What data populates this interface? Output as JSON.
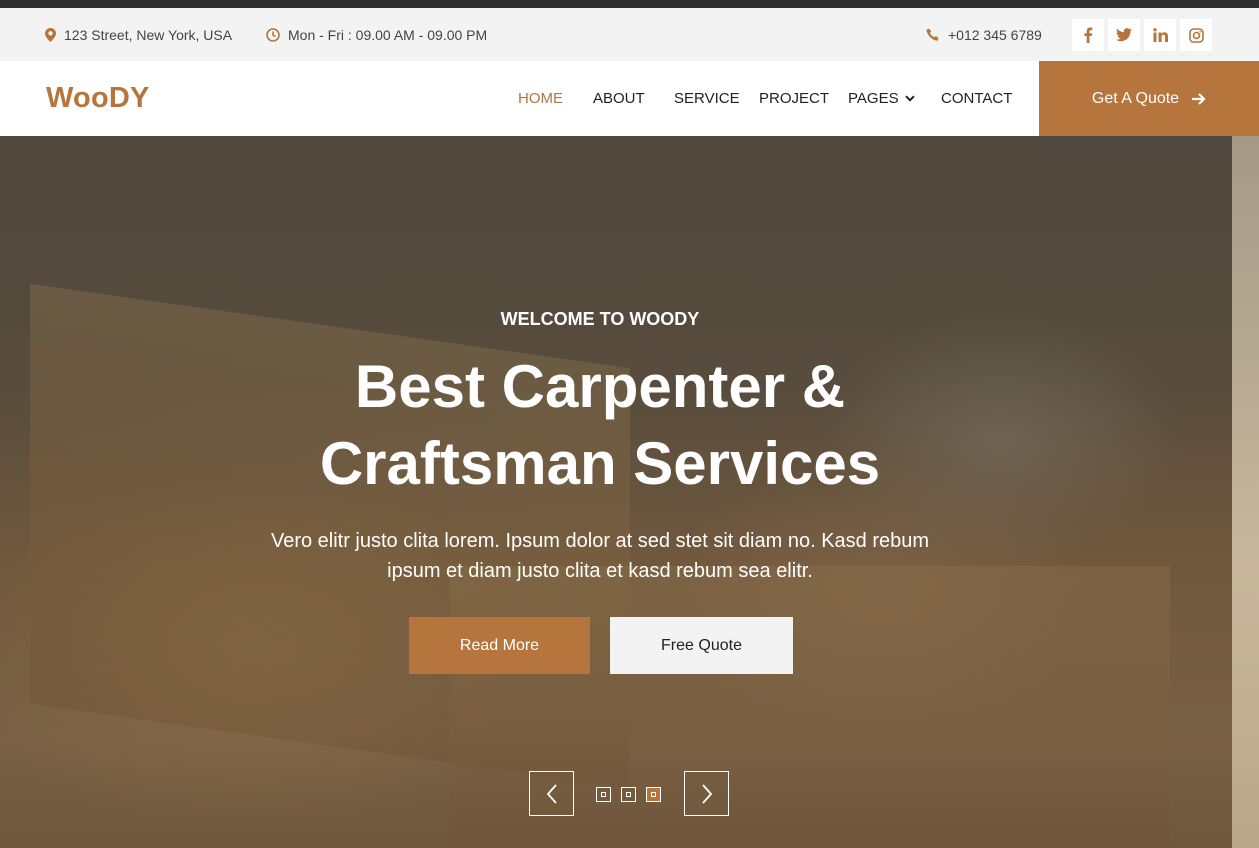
{
  "topbar": {
    "address": "123 Street, New York, USA",
    "hours": "Mon - Fri : 09.00 AM - 09.00 PM",
    "phone": "+012 345 6789",
    "social": [
      {
        "name": "facebook-icon",
        "glyph": "f"
      },
      {
        "name": "twitter-icon",
        "glyph": "t"
      },
      {
        "name": "linkedin-icon",
        "glyph": "in"
      },
      {
        "name": "instagram-icon",
        "glyph": "ig"
      }
    ]
  },
  "navbar": {
    "brand": "WooDY",
    "menu": [
      "HOME",
      "ABOUT",
      "SERVICE",
      "PROJECT",
      "PAGES",
      "CONTACT"
    ],
    "active": "HOME",
    "cta": "Get A Quote"
  },
  "hero": {
    "eyebrow": "WELCOME TO WOODY",
    "title_line1": "Best Carpenter &",
    "title_line2": "Craftsman Services",
    "description_line1": "Vero elitr justo clita lorem. Ipsum dolor at sed stet sit diam no. Kasd rebum",
    "description_line2": "ipsum et diam justo clita et kasd rebum sea elitr.",
    "primary_button": "Read More",
    "secondary_button": "Free Quote",
    "carousel": {
      "slides": 3,
      "active_slide": 3
    }
  },
  "colors": {
    "accent": "#b5753d",
    "topbar_bg": "#f3f3f3",
    "dark_line": "#2f2f2f"
  }
}
